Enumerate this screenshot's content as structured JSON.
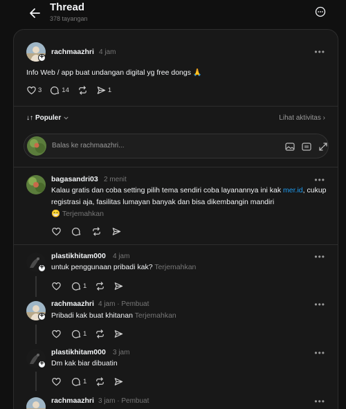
{
  "header": {
    "title": "Thread",
    "views": "378 tayangan"
  },
  "post": {
    "username": "rachmaazhri",
    "time": "4 jam",
    "text": "Info Web / app buat undangan digital yg free dongs 🙏",
    "likes": "3",
    "replies": "14",
    "shares": "1"
  },
  "sort": {
    "label": "Populer",
    "activity": "Lihat aktivitas"
  },
  "reply_input": {
    "placeholder": "Balas ke rachmaazhri..."
  },
  "comments": [
    {
      "username": "bagasandri03",
      "time": "2 menit",
      "text_before": "Kalau gratis dan coba setting pilih tema sendiri coba layanannya ini kak ",
      "link": "mer.id",
      "text_after": ", cukup registrasi aja, fasilitas lumayan banyak dan bisa dikembangin mandiri",
      "emoji": "😁",
      "translate": "Terjemahkan"
    },
    {
      "username": "plastikhitam000",
      "time": "4 jam",
      "text": "untuk penggunaan pribadi kak?",
      "translate": "Terjemahkan",
      "replies": "1"
    },
    {
      "username": "rachmaazhri",
      "time": "4 jam",
      "tag": "Pembuat",
      "text": "Pribadi kak buat khitanan",
      "translate": "Terjemahkan",
      "replies": "1"
    },
    {
      "username": "plastikhitam000",
      "time": "3 jam",
      "text": "Dm kak biar dibuatin",
      "replies": "1"
    },
    {
      "username": "rachmaazhri",
      "time": "3 jam",
      "tag": "Pembuat"
    }
  ],
  "colors": {
    "background": "#101010",
    "panel": "#181818",
    "link": "#1d9bf0",
    "muted": "#777777"
  }
}
